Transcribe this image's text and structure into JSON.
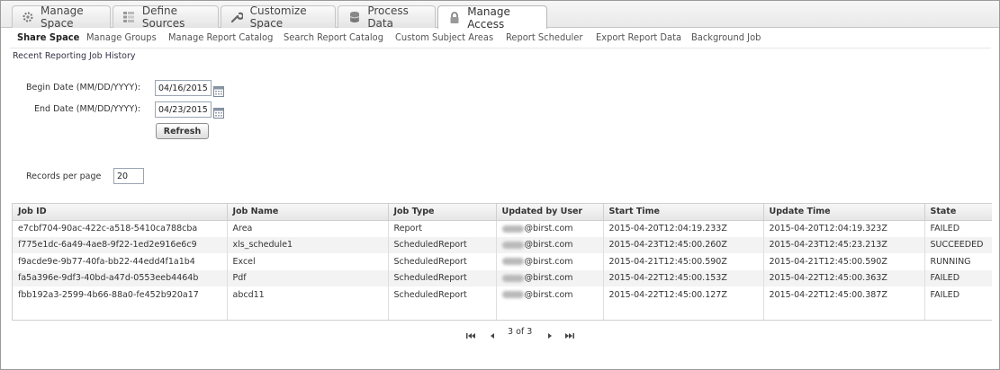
{
  "tabs": [
    {
      "label": "Manage Space",
      "icon": "gear-wheel-icon"
    },
    {
      "label": "Define Sources",
      "icon": "grid-icon"
    },
    {
      "label": "Customize Space",
      "icon": "wrench-icon"
    },
    {
      "label": "Process Data",
      "icon": "database-icon"
    },
    {
      "label": "Manage Access",
      "icon": "lock-icon",
      "active": true
    }
  ],
  "subnav": [
    {
      "label": "Share Space",
      "active": true
    },
    {
      "label": "Manage Groups"
    },
    {
      "label": "Manage Report Catalog"
    },
    {
      "label": "Search Report Catalog"
    },
    {
      "label": "Custom Subject Areas"
    },
    {
      "label": "Report Scheduler"
    },
    {
      "label": "Export Report Data"
    },
    {
      "label": "Background Job"
    }
  ],
  "section_title": "Recent Reporting Job History",
  "filters": {
    "begin_label": "Begin Date (MM/DD/YYYY):",
    "begin_value": "04/16/2015",
    "end_label": "End Date (MM/DD/YYYY):",
    "end_value": "04/23/2015",
    "refresh_label": "Refresh",
    "records_label": "Records per page",
    "records_value": "20"
  },
  "table": {
    "headers": [
      "Job ID",
      "Job Name",
      "Job Type",
      "Updated by User",
      "Start Time",
      "Update Time",
      "State"
    ],
    "rows": [
      [
        "e7cbf704-90ac-422c-a518-5410ca788cba",
        "Area",
        "Report",
        "@birst.com",
        "2015-04-20T12:04:19.233Z",
        "2015-04-20T12:04:19.323Z",
        "FAILED"
      ],
      [
        "f775e1dc-6a49-4ae8-9f22-1ed2e916e6c9",
        "xls_schedule1",
        "ScheduledReport",
        "@birst.com",
        "2015-04-23T12:45:00.260Z",
        "2015-04-23T12:45:23.213Z",
        "SUCCEEDED"
      ],
      [
        "f9acde9e-9b77-40fa-bb22-44edd4f1a1b4",
        "Excel",
        "ScheduledReport",
        "@birst.com",
        "2015-04-21T12:45:00.590Z",
        "2015-04-21T12:45:00.590Z",
        "RUNNING"
      ],
      [
        "fa5a396e-9df3-40bd-a47d-0553eeb4464b",
        "Pdf",
        "ScheduledReport",
        "@birst.com",
        "2015-04-22T12:45:00.153Z",
        "2015-04-22T12:45:00.363Z",
        "FAILED"
      ],
      [
        "fbb192a3-2599-4b66-88a0-fe452b920a17",
        "abcd11",
        "ScheduledReport",
        "@birst.com",
        "2015-04-22T12:45:00.127Z",
        "2015-04-22T12:45:00.387Z",
        "FAILED"
      ]
    ]
  },
  "pager": {
    "text": "3 of 3"
  }
}
